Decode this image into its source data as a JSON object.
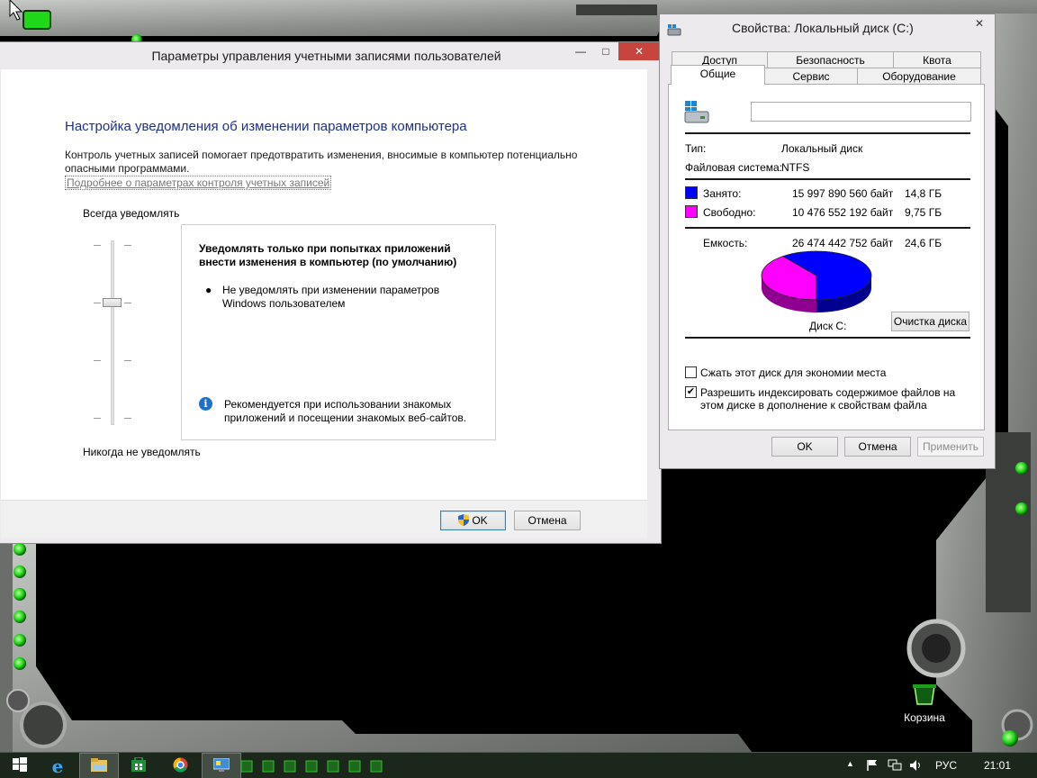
{
  "uac": {
    "title": "Параметры управления учетными записями пользователей",
    "heading": "Настройка уведомления об изменении параметров компьютера",
    "description": "Контроль учетных записей помогает предотвратить изменения, вносимые в компьютер потенциально опасными программами.",
    "link": "Подробнее о параметрах контроля учетных записей",
    "level_top": "Всегда уведомлять",
    "level_bottom": "Никогда не уведомлять",
    "slider_level": 3,
    "slider_levels_total": 4,
    "info_heading": "Уведомлять только при попытках приложений внести изменения в компьютер (по умолчанию)",
    "info_bullet": "Не уведомлять при изменении параметров Windows пользователем",
    "info_recommend": "Рекомендуется при использовании знакомых приложений и посещении знакомых веб-сайтов.",
    "ok_label": "OK",
    "cancel_label": "Отмена"
  },
  "props": {
    "title": "Свойства: Локальный диск (C:)",
    "tabs_row1": [
      "Доступ",
      "Безопасность",
      "Квота"
    ],
    "tabs_row2": [
      "Общие",
      "Сервис",
      "Оборудование"
    ],
    "active_tab": "Общие",
    "name_value": "",
    "type_label": "Тип:",
    "type_value": "Локальный диск",
    "fs_label": "Файловая система:",
    "fs_value": "NTFS",
    "used_label": "Занято:",
    "used_bytes": "15 997 890 560 байт",
    "used_size": "14,8 ГБ",
    "used_color": "#0000ff",
    "free_label": "Свободно:",
    "free_bytes": "10 476 552 192 байт",
    "free_size": "9,75 ГБ",
    "free_color": "#ff00ff",
    "capacity_label": "Емкость:",
    "capacity_bytes": "26 474 442 752 байт",
    "capacity_size": "24,6 ГБ",
    "disk_label": "Диск C:",
    "cleanup_label": "Очистка диска",
    "compress_label": "Сжать этот диск для экономии места",
    "compress_checked": false,
    "index_label": "Разрешить индексировать содержимое файлов на этом диске в дополнение к свойствам файла",
    "index_checked": true,
    "ok_label": "OK",
    "cancel_label": "Отмена",
    "apply_label": "Применить"
  },
  "desktop": {
    "recycle_bin_label": "Корзина"
  },
  "taskbar": {
    "items": [
      "start-icon",
      "internet-explorer-icon",
      "file-explorer-icon",
      "store-icon",
      "chrome-icon",
      "control-panel-icon"
    ],
    "language": "РУС",
    "clock": "21:01"
  }
}
